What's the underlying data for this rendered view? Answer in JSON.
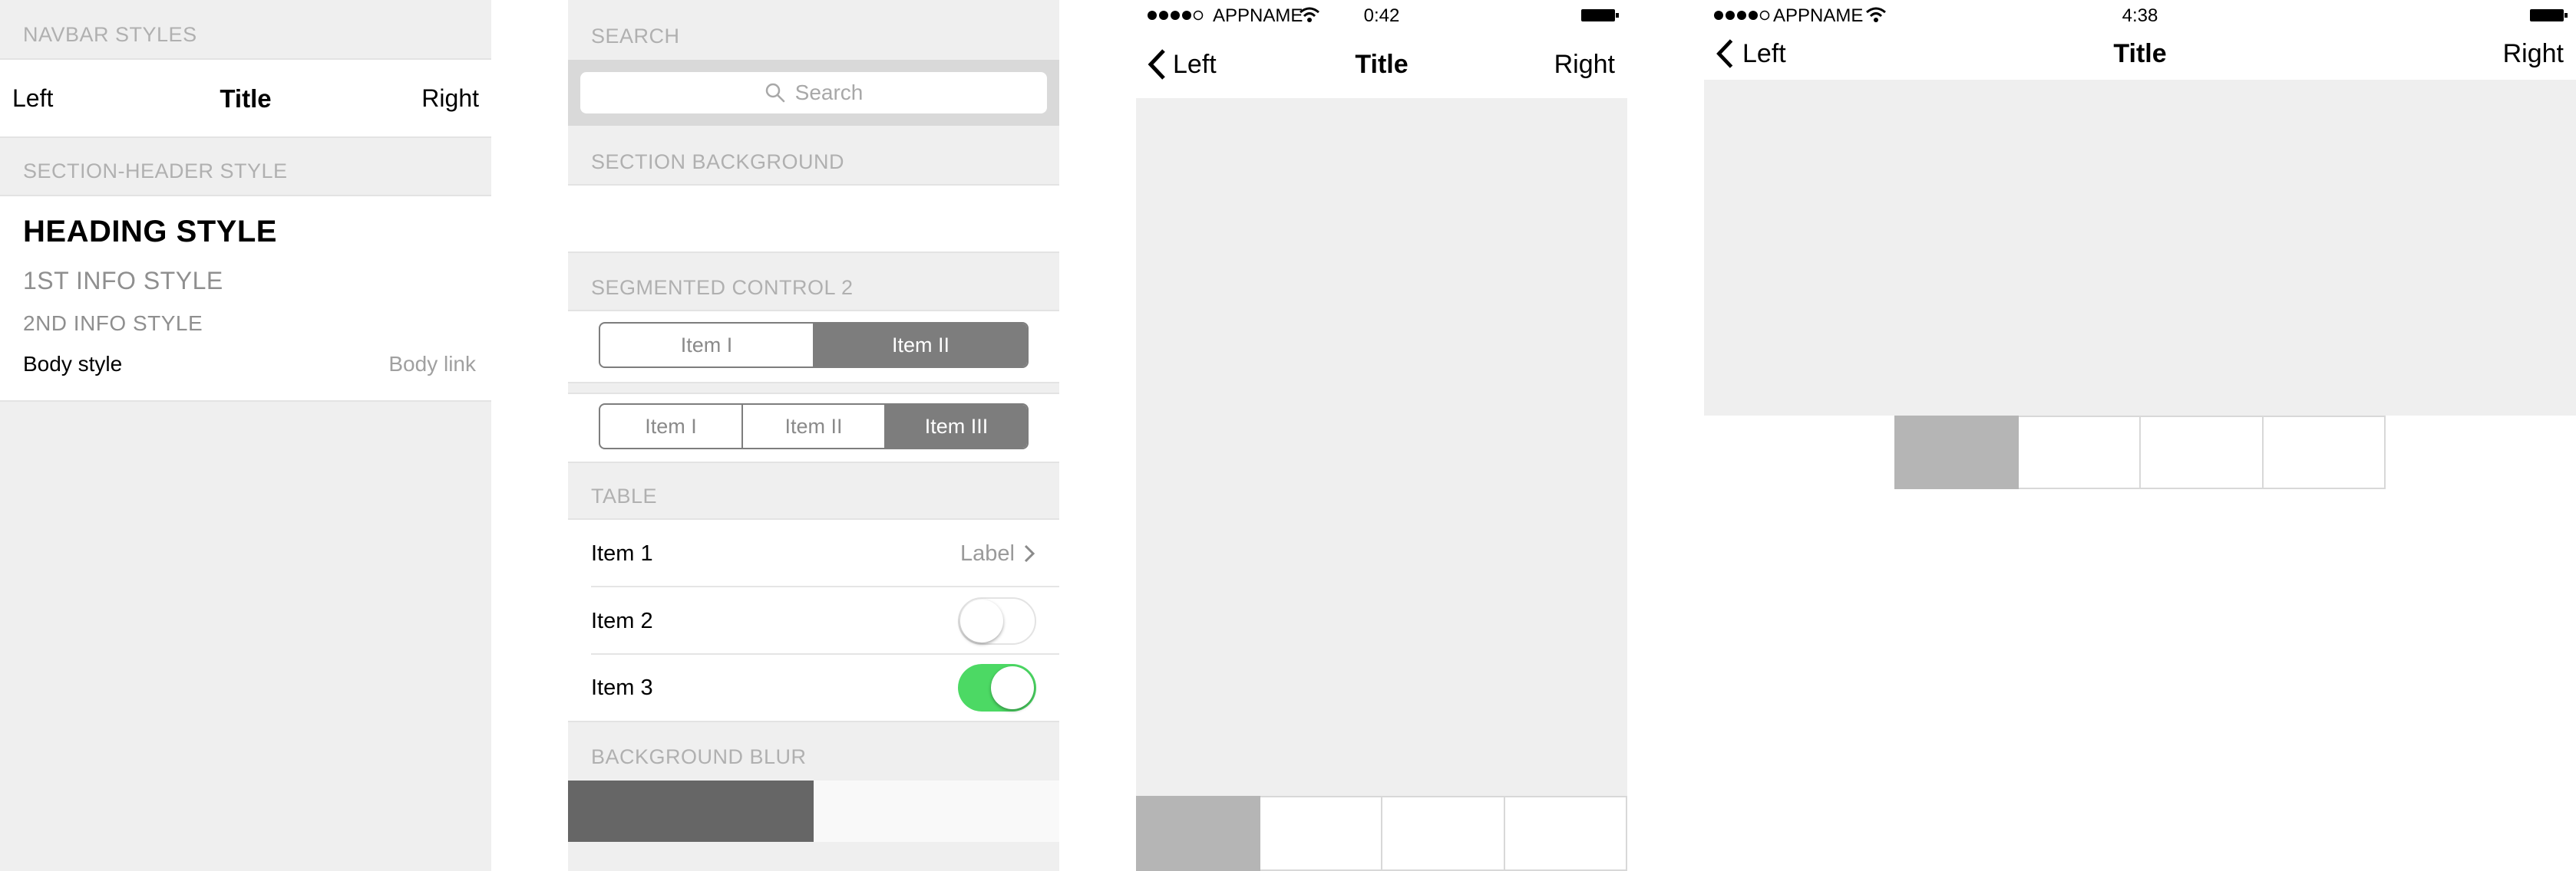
{
  "styleguide": {
    "navbar_header": "NAVBAR STYLES",
    "navbar_left": "Left",
    "navbar_title": "Title",
    "navbar_right": "Right",
    "section_header": "SECTION-HEADER STYLE",
    "heading": "HEADING STYLE",
    "info1": "1ST INFO STYLE",
    "info2": "2ND INFO STYLE",
    "body": "Body style",
    "body_link": "Body link"
  },
  "components": {
    "search_header": "SEARCH",
    "search_placeholder": "Search",
    "section_background_header": "SECTION BACKGROUND",
    "segmented_header": "SEGMENTED CONTROL 2",
    "segmented_two": [
      "Item I",
      "Item II"
    ],
    "segmented_two_selected": 1,
    "segmented_three": [
      "Item I",
      "Item II",
      "Item III"
    ],
    "segmented_three_selected": 2,
    "table_header": "TABLE",
    "table_rows": [
      {
        "label": "Item 1",
        "detail": "Label"
      },
      {
        "label": "Item 2",
        "toggle": false
      },
      {
        "label": "Item 3",
        "toggle": true
      }
    ],
    "blur_header": "BACKGROUND BLUR"
  },
  "phone1": {
    "carrier": "APPNAME",
    "time": "0:42",
    "nav_left": "Left",
    "nav_title": "Title",
    "nav_right": "Right",
    "tabs_selected": 0
  },
  "phone2": {
    "carrier": "APPNAME",
    "time": "4:38",
    "nav_left": "Left",
    "nav_title": "Title",
    "nav_right": "Right",
    "tabs_selected": 0
  },
  "colors": {
    "background": "#efefef",
    "accent_gray": "#7d7d7d",
    "toggle_on": "#4cd964",
    "tab_selected": "#b5b5b5"
  }
}
